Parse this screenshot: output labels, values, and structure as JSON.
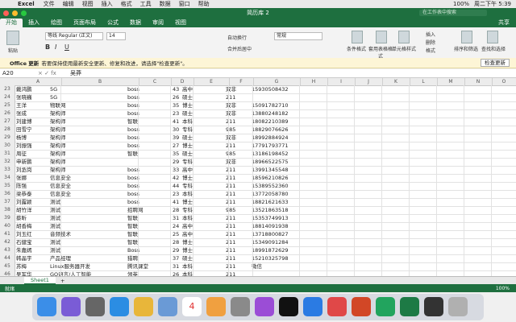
{
  "menubar": {
    "app": "Excel",
    "items": [
      "文件",
      "编辑",
      "视图",
      "插入",
      "格式",
      "工具",
      "数据",
      "窗口",
      "帮助"
    ],
    "battery": "100%",
    "clock": "周二下午 5:39"
  },
  "window": {
    "title": "简历库 2",
    "search_placeholder": "在工作表中搜索"
  },
  "ribbon_tabs": [
    "开始",
    "插入",
    "绘图",
    "页面布局",
    "公式",
    "数据",
    "审阅",
    "视图"
  ],
  "share_label": "共享",
  "ribbon": {
    "paste": "粘贴",
    "font_name": "等线 Regular (正文)",
    "font_size": "14",
    "wrap": "自动换行",
    "number_format": "常规",
    "merge": "合并后居中",
    "cond": "条件格式",
    "table": "套用表格格式",
    "cellstyle": "单元格样式",
    "insert": "插入",
    "delete": "删除",
    "format": "格式",
    "sort": "排序和筛选",
    "find": "查找和选择"
  },
  "notice": {
    "bold": "Office 更新",
    "text": "若要保持使用最新安全更新、修复和改进，请选择\"检查更新\"。",
    "button": "检查更新"
  },
  "formula": {
    "cell": "A20",
    "value": "吴莽"
  },
  "columns": [
    "A",
    "B",
    "C",
    "D",
    "E",
    "F",
    "G",
    "H",
    "I",
    "J",
    "K",
    "L",
    "M",
    "N",
    "O"
  ],
  "rows": [
    {
      "n": "23",
      "a": "戴鸿鹏",
      "b": "5G",
      "c": "boss",
      "d": "43",
      "e": "高中",
      "f": "双非",
      "g": "15930508432"
    },
    {
      "n": "24",
      "a": "张晓巍",
      "b": "5G",
      "c": "boss",
      "d": "26",
      "e": "硕士",
      "f": "211",
      "g": ""
    },
    {
      "n": "25",
      "a": "王洋",
      "b": "物联网",
      "c": "boss",
      "d": "35",
      "e": "博士",
      "f": "双非",
      "g": "15091782710"
    },
    {
      "n": "26",
      "a": "张成",
      "b": "架构师",
      "c": "boss",
      "d": "23",
      "e": "硕士",
      "f": "双非",
      "g": "13880248182"
    },
    {
      "n": "27",
      "a": "刘建博",
      "b": "架构师",
      "c": "智联",
      "d": "41",
      "e": "本科",
      "f": "211",
      "g": "18082210389"
    },
    {
      "n": "28",
      "a": "田雪宁",
      "b": "架构师",
      "c": "boss",
      "d": "30",
      "e": "专科",
      "f": "985",
      "g": "18829076626"
    },
    {
      "n": "29",
      "a": "杨博",
      "b": "架构师",
      "c": "boss",
      "d": "39",
      "e": "硕士",
      "f": "双非",
      "g": "18992884924"
    },
    {
      "n": "30",
      "a": "刘振强",
      "b": "架构师",
      "c": "boss",
      "d": "27",
      "e": "博士",
      "f": "211",
      "g": "17791793771"
    },
    {
      "n": "31",
      "a": "周征",
      "b": "架构师",
      "c": "智联",
      "d": "35",
      "e": "硕士",
      "f": "985",
      "g": "13186198452"
    },
    {
      "n": "32",
      "a": "申新鹏",
      "b": "架构师",
      "c": "",
      "d": "29",
      "e": "专科",
      "f": "双非",
      "g": "18966522575"
    },
    {
      "n": "33",
      "a": "刘丞岗",
      "b": "架构师",
      "c": "boss",
      "d": "33",
      "e": "高中",
      "f": "211",
      "g": "13991345548"
    },
    {
      "n": "34",
      "a": "张娜",
      "b": "信息安全",
      "c": "boss",
      "d": "42",
      "e": "博士",
      "f": "211",
      "g": "18596210826"
    },
    {
      "n": "35",
      "a": "陈强",
      "b": "信息安全",
      "c": "boss",
      "d": "44",
      "e": "专科",
      "f": "211",
      "g": "15389552360"
    },
    {
      "n": "36",
      "a": "梁恭泰",
      "b": "信息安全",
      "c": "boss",
      "d": "23",
      "e": "本科",
      "f": "211",
      "g": "13772058780"
    },
    {
      "n": "37",
      "a": "刘露颖",
      "b": "测试",
      "c": "boss",
      "d": "41",
      "e": "博士",
      "f": "211",
      "g": "18821621633"
    },
    {
      "n": "38",
      "a": "胡竹洋",
      "b": "测试",
      "c": "招聘网",
      "d": "28",
      "e": "专科",
      "f": "985",
      "g": "13521863518"
    },
    {
      "n": "39",
      "a": "蔡昕",
      "b": "测试",
      "c": "智联",
      "d": "31",
      "e": "本科",
      "f": "211",
      "g": "15353749913"
    },
    {
      "n": "40",
      "a": "胡香梅",
      "b": "测试",
      "c": "智联",
      "d": "24",
      "e": "高中",
      "f": "211",
      "g": "18814091938"
    },
    {
      "n": "41",
      "a": "刘玉红",
      "b": "音频技术",
      "c": "智联",
      "d": "25",
      "e": "高中",
      "f": "211",
      "g": "13718800827"
    },
    {
      "n": "42",
      "a": "石健宝",
      "b": "测试",
      "c": "智联",
      "d": "28",
      "e": "博士",
      "f": "211",
      "g": "15349091284"
    },
    {
      "n": "43",
      "a": "朱嘉嫣",
      "b": "测试",
      "c": "Boss",
      "d": "29",
      "e": "博士",
      "f": "211",
      "g": "18991872629"
    },
    {
      "n": "44",
      "a": "韩晶宇",
      "b": "产品经理",
      "c": "猎聘",
      "d": "37",
      "e": "硕士",
      "f": "211",
      "g": "15210325798"
    },
    {
      "n": "45",
      "a": "苏梅",
      "b": "Linux服务器开发",
      "c": "腾讯课堂",
      "d": "31",
      "e": "本科",
      "f": "211",
      "g": "微信"
    },
    {
      "n": "46",
      "a": "吴军华",
      "b": "GO语言/人工智能",
      "c": "领英",
      "d": "26",
      "e": "本科",
      "f": "211",
      "g": ""
    },
    {
      "n": "47",
      "a": "程泽",
      "b": "测试",
      "c": "Boss",
      "d": "33",
      "e": "本科",
      "f": "211",
      "g": "微信"
    }
  ],
  "sheet_tab": "Sheet1",
  "status": {
    "ready": "就绪",
    "zoom": "100%"
  },
  "dock": [
    "Finder",
    "Siri",
    "Launchpad",
    "Safari",
    "Chrome",
    "Preview",
    "Calendar",
    "Photos",
    "Settings",
    "Podcasts",
    "TV",
    "Feishu",
    "Clock",
    "PowerPoint",
    "PyCharm",
    "Excel",
    "QuickTime",
    "Trash"
  ],
  "dock_calendar_day": "4"
}
